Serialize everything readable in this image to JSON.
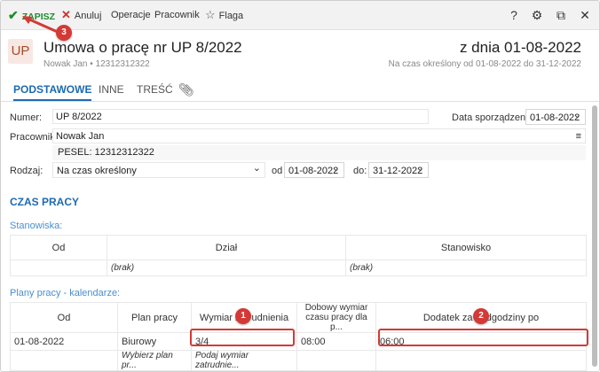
{
  "toolbar": {
    "save": "ZAPISZ",
    "cancel": "Anuluj",
    "operations": "Operacje",
    "employee": "Pracownik",
    "flag": "Flaga",
    "help": "?",
    "settings": "⚙",
    "restore": "⧉",
    "close": "✕"
  },
  "header": {
    "badge": "UP",
    "title": "Umowa o pracę nr UP 8/2022",
    "subtitle": "Nowak Jan  •  12312312322",
    "date_title": "z dnia 01-08-2022",
    "date_subtitle": "Na czas określony od 01-08-2022 do 31-12-2022"
  },
  "tabs": [
    "PODSTAWOWE",
    "INNE",
    "TREŚĆ"
  ],
  "form": {
    "number_label": "Numer:",
    "number_value": "UP 8/2022",
    "date_label": "Data sporządzenia:",
    "date_value": "01-08-2022",
    "employee_label": "Pracownik:",
    "employee_value": "Nowak Jan",
    "pesel": "PESEL:  12312312322",
    "type_label": "Rodzaj:",
    "type_value": "Na czas określony",
    "from_label": "od",
    "from_value": "01-08-2022",
    "to_label": "do:",
    "to_value": "31-12-2022"
  },
  "work_time": {
    "section": "CZAS PRACY",
    "positions_label": "Stanowiska:",
    "positions_headers": [
      "Od",
      "Dział",
      "Stanowisko"
    ],
    "positions_empty": "(brak)",
    "plans_label": "Plany pracy - kalendarze:",
    "plans_headers": [
      "Od",
      "Plan pracy",
      "Wymiar zatrudnienia",
      "Dobowy wymiar czasu pracy dla p...",
      "Dodatek za nadgodziny po"
    ],
    "plans_row": [
      "01-08-2022",
      "Biurowy",
      "3/4",
      "08:00",
      "06:00"
    ],
    "plans_placeholder_plan": "Wybierz plan pr...",
    "plans_placeholder_dim": "Podaj wymiar zatrudnie..."
  },
  "callouts": [
    "1",
    "2",
    "3"
  ],
  "colors": {
    "accent": "#1d6ab0",
    "save": "#1e8b2c",
    "cancel": "#d0302b",
    "callout": "#d33a36"
  }
}
